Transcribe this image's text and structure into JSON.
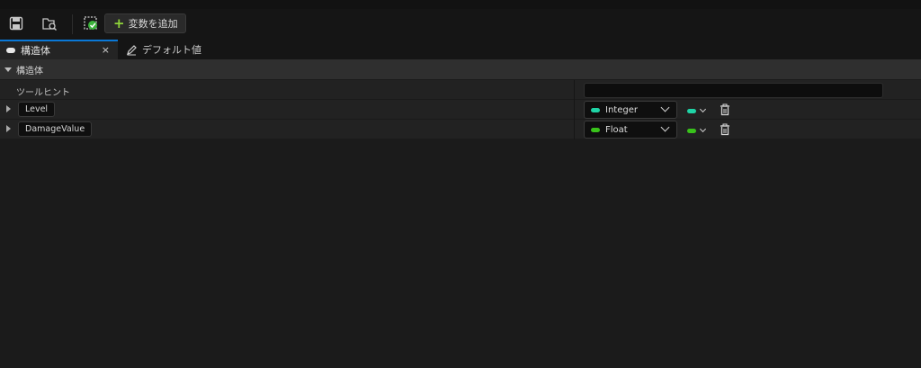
{
  "toolbar": {
    "save_icon": "save-icon",
    "browse_icon": "browse-icon",
    "struct_icon": "struct-check-icon",
    "add_variable_label": "変数を追加"
  },
  "tabs": [
    {
      "label": "構造体",
      "icon": "struct-pill-icon",
      "active": true,
      "close_label": "×"
    },
    {
      "label": "デフォルト値",
      "icon": "edit-pencil-icon",
      "active": false
    }
  ],
  "category": {
    "label": "構造体"
  },
  "tooltip_row": {
    "label": "ツールヒント",
    "value": ""
  },
  "variables": [
    {
      "name": "Level",
      "type": "Integer",
      "color": "#1fd3a6"
    },
    {
      "name": "DamageValue",
      "type": "Float",
      "color": "#39c21b"
    }
  ],
  "colors": {
    "accent": "#0a78d7",
    "add_plus": "#8fd33a"
  }
}
